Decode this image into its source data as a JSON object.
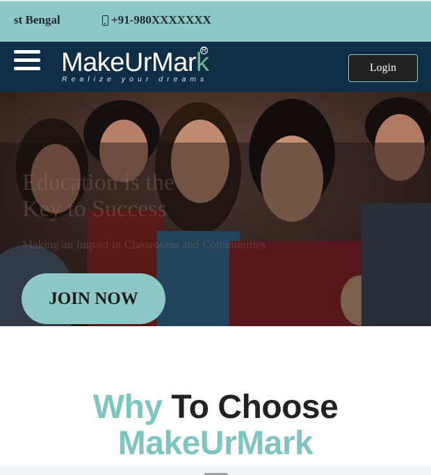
{
  "topbar": {
    "location": "st Bengal",
    "phone": "+91-980XXXXXXX"
  },
  "navbar": {
    "brand_prefix": "MakeUr",
    "brand_mark_letter": "M",
    "brand_suffix": "ar",
    "brand_check": "k",
    "tagline": "Realize your dreams",
    "login_label": "Login"
  },
  "hero": {
    "line1": "Education is the",
    "line2": "Key to Success",
    "line3": "Making an Impact in Classrooms and Communities",
    "join_label": "JOIN NOW"
  },
  "section": {
    "why_word": "Why",
    "to_choose": "To Choose",
    "brand": "MakeUrMark"
  },
  "colors": {
    "teal": "#8ec8c6",
    "navy": "#0f2d45",
    "accent_green": "#6fb98c",
    "dark_text": "#222222"
  },
  "icons": {
    "menu": "hamburger-menu-icon",
    "phone": "phone-icon"
  }
}
